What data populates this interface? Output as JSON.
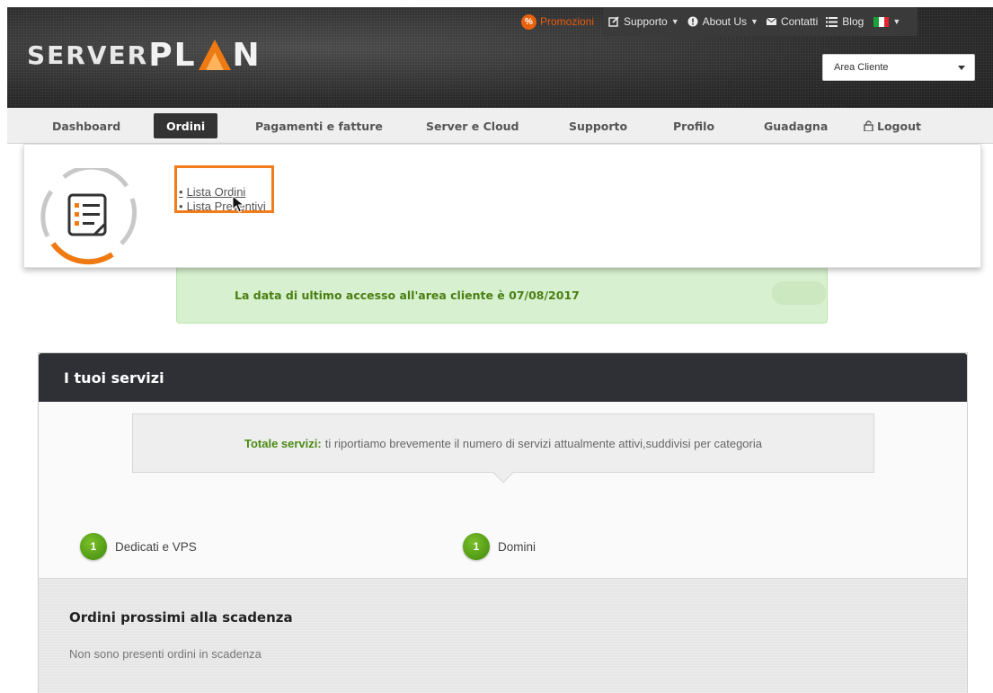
{
  "header": {
    "logo_left": "SERVER",
    "logo_right": "PL",
    "logo_end": "N",
    "promo_label": "Promozioni",
    "promo_icon": "percent-icon",
    "menu": [
      {
        "label": "Supporto",
        "icon": "edit-icon"
      },
      {
        "label": "About Us",
        "icon": "info-icon"
      },
      {
        "label": "Contatti",
        "icon": "mail-icon"
      },
      {
        "label": "Blog",
        "icon": "list-icon"
      }
    ],
    "language_flag": "it-flag-icon",
    "area_select": {
      "value": "Area Cliente"
    }
  },
  "nav": {
    "items": [
      {
        "label": "Dashboard"
      },
      {
        "label": "Ordini",
        "active": true
      },
      {
        "label": "Pagamenti e fatture"
      },
      {
        "label": "Server e Cloud"
      },
      {
        "label": "Supporto"
      },
      {
        "label": "Profilo"
      },
      {
        "label": "Guadagna"
      },
      {
        "label": "Logout",
        "icon": "lock-icon"
      }
    ]
  },
  "dropdown": {
    "items": [
      {
        "label": "Lista Ordini"
      },
      {
        "label": "Lista Preventivi"
      }
    ]
  },
  "notice": {
    "text": "La data di ultimo accesso all'area cliente è 07/08/2017"
  },
  "services": {
    "title": "I tuoi servizi",
    "total_label": "Totale servizi:",
    "total_text": "ti riportiamo brevemente il numero di servizi attualmente attivi,suddivisi per categoria",
    "counters": [
      {
        "count": "1",
        "label": "Dedicati e VPS"
      },
      {
        "count": "1",
        "label": "Domini"
      }
    ]
  },
  "expiring": {
    "title": "Ordini prossimi alla scadenza",
    "text": "Non sono presenti ordini in scadenza"
  },
  "colors": {
    "accent": "#f27b1a",
    "header_dark": "#2b2b2b",
    "green_text": "#4a7f12",
    "badge_green": "#4f9a12"
  }
}
